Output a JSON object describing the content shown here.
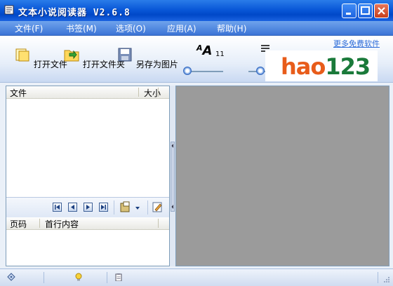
{
  "window": {
    "title": "文本小说阅读器 V2.6.8"
  },
  "menu": [
    {
      "label": "文件(F)"
    },
    {
      "label": "书签(M)"
    },
    {
      "label": "选项(O)"
    },
    {
      "label": "应用(A)"
    },
    {
      "label": "帮助(H)"
    }
  ],
  "toolbar": {
    "open_file": "打开文件",
    "open_folder": "打开文件夹",
    "save_as_image": "另存为图片",
    "font_size_value": "11",
    "font_size_level": 0.1,
    "line_spacing_level": 0.1
  },
  "promo": {
    "more_link": "更多免费软件",
    "logo_text": "hao123"
  },
  "file_list": {
    "col_file": "文件",
    "col_size": "大小"
  },
  "page_list": {
    "col_page": "页码",
    "col_first_line": "首行内容"
  },
  "colors": {
    "titlebar": "#0a58d8",
    "viewer_bg": "#9b9b9b",
    "accent": "#2a6ad8"
  }
}
